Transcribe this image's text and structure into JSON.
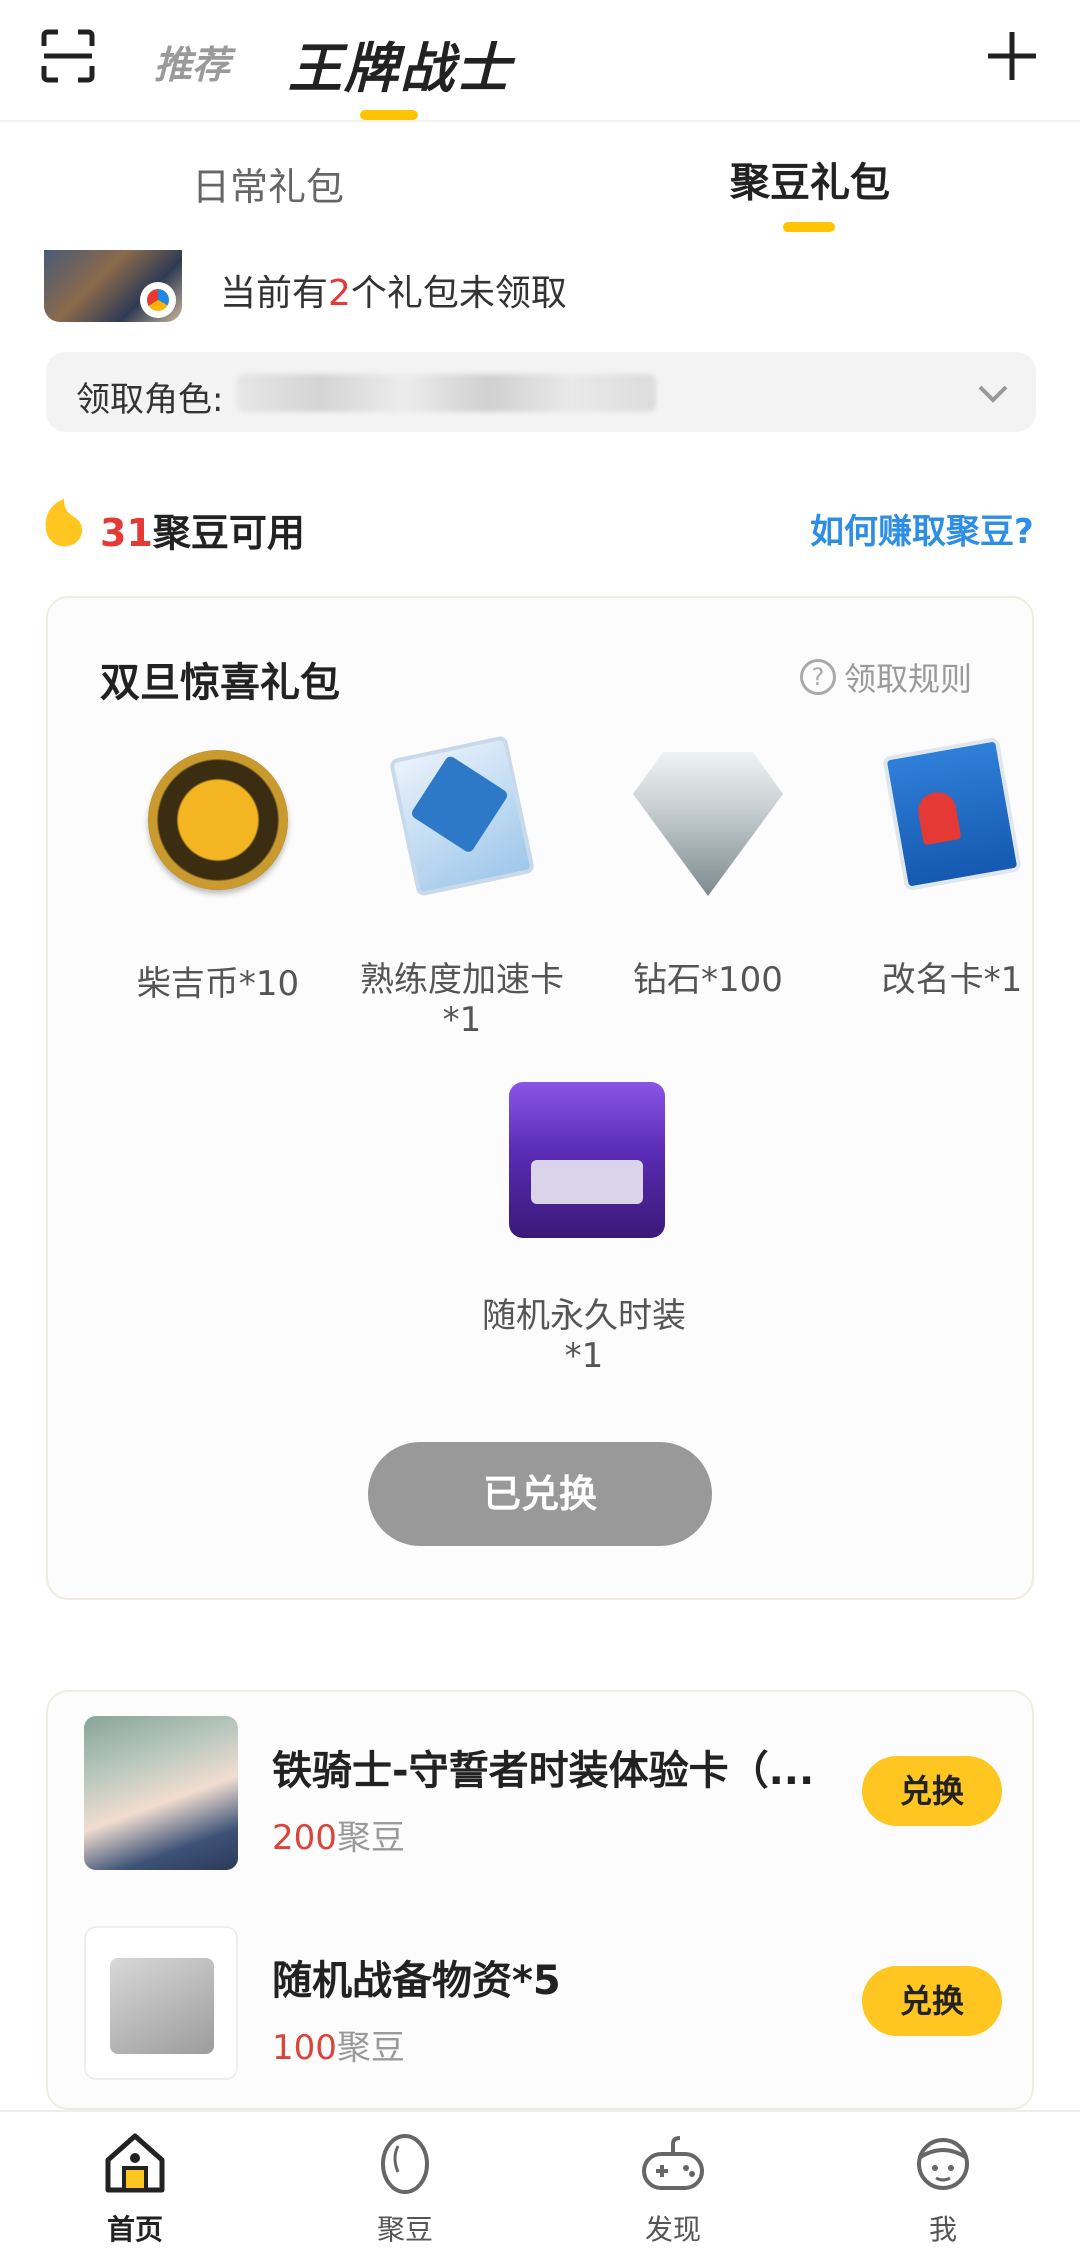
{
  "header": {
    "tab_recommend": "推荐",
    "tab_game": "王牌战士",
    "accent_color": "#ffc400"
  },
  "subtabs": {
    "daily": "日常礼包",
    "bean": "聚豆礼包"
  },
  "info": {
    "prefix": "当前有",
    "count": "2",
    "suffix": "个礼包未领取"
  },
  "role": {
    "label": "领取角色:"
  },
  "beans": {
    "count": "31",
    "label": "聚豆可用",
    "earn_link": "如何赚取聚豆?"
  },
  "gift_pack": {
    "title": "双旦惊喜礼包",
    "rules": "领取规则",
    "items": [
      {
        "name": "柴吉币*10",
        "icon": "shiba-coin-icon"
      },
      {
        "name": "熟练度加速卡*1",
        "icon": "double-exp-card-icon"
      },
      {
        "name": "钻石*100",
        "icon": "diamond-icon"
      },
      {
        "name": "改名卡*1",
        "icon": "rename-card-icon"
      },
      {
        "name": "随机永久时装*1",
        "icon": "costume-chest-icon"
      }
    ],
    "button": "已兑换"
  },
  "exchange": [
    {
      "title": "铁骑士-守誓者时装体验卡（...",
      "price": "200",
      "unit": "聚豆",
      "button": "兑换"
    },
    {
      "title": "随机战备物资*5",
      "price": "100",
      "unit": "聚豆",
      "button": "兑换"
    }
  ],
  "bottom_nav": [
    {
      "label": "首页",
      "icon": "home-icon"
    },
    {
      "label": "聚豆",
      "icon": "bean-icon"
    },
    {
      "label": "发现",
      "icon": "gamepad-icon"
    },
    {
      "label": "我",
      "icon": "profile-icon"
    }
  ]
}
